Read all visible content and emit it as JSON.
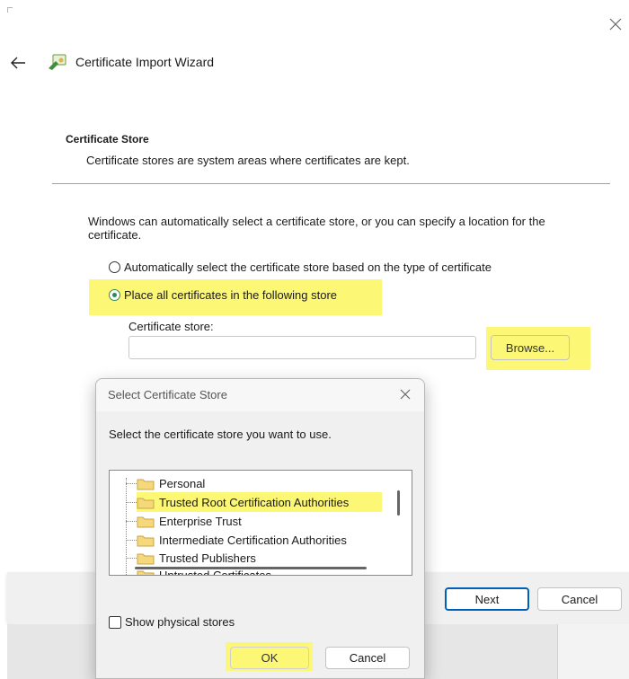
{
  "wizard": {
    "title": "Certificate Import Wizard",
    "section_title": "Certificate Store",
    "section_desc": "Certificate stores are system areas where certificates are kept.",
    "paragraph": "Windows can automatically select a certificate store, or you can specify a location for the certificate.",
    "option_auto": "Automatically select the certificate store based on the type of certificate",
    "option_place": "Place all certificates in the following store",
    "selected_option": "option_place",
    "store_label": "Certificate store:",
    "store_value": "",
    "browse_label": "Browse...",
    "next_label": "Next",
    "cancel_label": "Cancel"
  },
  "dialog": {
    "title": "Select Certificate Store",
    "prompt": "Select the certificate store you want to use.",
    "stores": [
      "Personal",
      "Trusted Root Certification Authorities",
      "Enterprise Trust",
      "Intermediate Certification Authorities",
      "Trusted Publishers",
      "Untrusted Certificates"
    ],
    "selected_store": "Trusted Root Certification Authorities",
    "show_physical_label": "Show physical stores",
    "show_physical_checked": false,
    "ok_label": "OK",
    "cancel_label": "Cancel"
  },
  "colors": {
    "highlight": "#fdf776",
    "accent": "#005fb8",
    "radio_selected": "#2e8b57",
    "folder": "#f5d87a"
  },
  "icons": [
    "close-icon",
    "back-arrow-icon",
    "certificate-icon",
    "folder-icon",
    "checkbox-icon"
  ]
}
